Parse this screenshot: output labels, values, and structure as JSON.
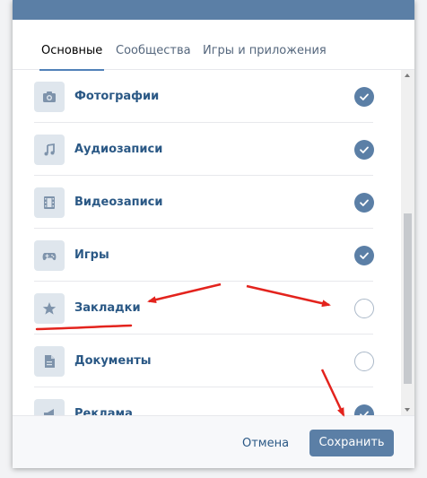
{
  "tabs": [
    {
      "label": "Основные",
      "active": true
    },
    {
      "label": "Сообщества",
      "active": false
    },
    {
      "label": "Игры и приложения",
      "active": false
    }
  ],
  "items": [
    {
      "label": "Фотографии",
      "icon": "camera-icon",
      "checked": true
    },
    {
      "label": "Аудиозаписи",
      "icon": "music-note-icon",
      "checked": true
    },
    {
      "label": "Видеозаписи",
      "icon": "film-icon",
      "checked": true
    },
    {
      "label": "Игры",
      "icon": "gamepad-icon",
      "checked": true
    },
    {
      "label": "Закладки",
      "icon": "star-icon",
      "checked": false
    },
    {
      "label": "Документы",
      "icon": "document-icon",
      "checked": false
    },
    {
      "label": "Реклама",
      "icon": "megaphone-icon",
      "checked": true
    }
  ],
  "footer": {
    "cancel_label": "Отмена",
    "save_label": "Сохранить"
  },
  "colors": {
    "accent": "#5b7fa6",
    "link": "#2a5885",
    "annotation": "#e3231d"
  }
}
